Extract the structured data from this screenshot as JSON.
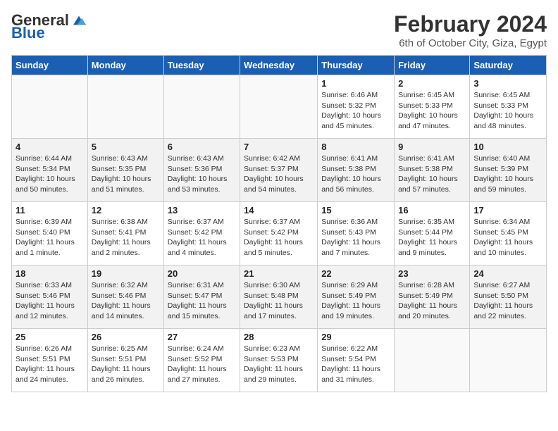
{
  "logo": {
    "general": "General",
    "blue": "Blue"
  },
  "title": "February 2024",
  "subtitle": "6th of October City, Giza, Egypt",
  "days_of_week": [
    "Sunday",
    "Monday",
    "Tuesday",
    "Wednesday",
    "Thursday",
    "Friday",
    "Saturday"
  ],
  "weeks": [
    [
      {
        "day": "",
        "info": ""
      },
      {
        "day": "",
        "info": ""
      },
      {
        "day": "",
        "info": ""
      },
      {
        "day": "",
        "info": ""
      },
      {
        "day": "1",
        "info": "Sunrise: 6:46 AM\nSunset: 5:32 PM\nDaylight: 10 hours and 45 minutes."
      },
      {
        "day": "2",
        "info": "Sunrise: 6:45 AM\nSunset: 5:33 PM\nDaylight: 10 hours and 47 minutes."
      },
      {
        "day": "3",
        "info": "Sunrise: 6:45 AM\nSunset: 5:33 PM\nDaylight: 10 hours and 48 minutes."
      }
    ],
    [
      {
        "day": "4",
        "info": "Sunrise: 6:44 AM\nSunset: 5:34 PM\nDaylight: 10 hours and 50 minutes."
      },
      {
        "day": "5",
        "info": "Sunrise: 6:43 AM\nSunset: 5:35 PM\nDaylight: 10 hours and 51 minutes."
      },
      {
        "day": "6",
        "info": "Sunrise: 6:43 AM\nSunset: 5:36 PM\nDaylight: 10 hours and 53 minutes."
      },
      {
        "day": "7",
        "info": "Sunrise: 6:42 AM\nSunset: 5:37 PM\nDaylight: 10 hours and 54 minutes."
      },
      {
        "day": "8",
        "info": "Sunrise: 6:41 AM\nSunset: 5:38 PM\nDaylight: 10 hours and 56 minutes."
      },
      {
        "day": "9",
        "info": "Sunrise: 6:41 AM\nSunset: 5:38 PM\nDaylight: 10 hours and 57 minutes."
      },
      {
        "day": "10",
        "info": "Sunrise: 6:40 AM\nSunset: 5:39 PM\nDaylight: 10 hours and 59 minutes."
      }
    ],
    [
      {
        "day": "11",
        "info": "Sunrise: 6:39 AM\nSunset: 5:40 PM\nDaylight: 11 hours and 1 minute."
      },
      {
        "day": "12",
        "info": "Sunrise: 6:38 AM\nSunset: 5:41 PM\nDaylight: 11 hours and 2 minutes."
      },
      {
        "day": "13",
        "info": "Sunrise: 6:37 AM\nSunset: 5:42 PM\nDaylight: 11 hours and 4 minutes."
      },
      {
        "day": "14",
        "info": "Sunrise: 6:37 AM\nSunset: 5:42 PM\nDaylight: 11 hours and 5 minutes."
      },
      {
        "day": "15",
        "info": "Sunrise: 6:36 AM\nSunset: 5:43 PM\nDaylight: 11 hours and 7 minutes."
      },
      {
        "day": "16",
        "info": "Sunrise: 6:35 AM\nSunset: 5:44 PM\nDaylight: 11 hours and 9 minutes."
      },
      {
        "day": "17",
        "info": "Sunrise: 6:34 AM\nSunset: 5:45 PM\nDaylight: 11 hours and 10 minutes."
      }
    ],
    [
      {
        "day": "18",
        "info": "Sunrise: 6:33 AM\nSunset: 5:46 PM\nDaylight: 11 hours and 12 minutes."
      },
      {
        "day": "19",
        "info": "Sunrise: 6:32 AM\nSunset: 5:46 PM\nDaylight: 11 hours and 14 minutes."
      },
      {
        "day": "20",
        "info": "Sunrise: 6:31 AM\nSunset: 5:47 PM\nDaylight: 11 hours and 15 minutes."
      },
      {
        "day": "21",
        "info": "Sunrise: 6:30 AM\nSunset: 5:48 PM\nDaylight: 11 hours and 17 minutes."
      },
      {
        "day": "22",
        "info": "Sunrise: 6:29 AM\nSunset: 5:49 PM\nDaylight: 11 hours and 19 minutes."
      },
      {
        "day": "23",
        "info": "Sunrise: 6:28 AM\nSunset: 5:49 PM\nDaylight: 11 hours and 20 minutes."
      },
      {
        "day": "24",
        "info": "Sunrise: 6:27 AM\nSunset: 5:50 PM\nDaylight: 11 hours and 22 minutes."
      }
    ],
    [
      {
        "day": "25",
        "info": "Sunrise: 6:26 AM\nSunset: 5:51 PM\nDaylight: 11 hours and 24 minutes."
      },
      {
        "day": "26",
        "info": "Sunrise: 6:25 AM\nSunset: 5:51 PM\nDaylight: 11 hours and 26 minutes."
      },
      {
        "day": "27",
        "info": "Sunrise: 6:24 AM\nSunset: 5:52 PM\nDaylight: 11 hours and 27 minutes."
      },
      {
        "day": "28",
        "info": "Sunrise: 6:23 AM\nSunset: 5:53 PM\nDaylight: 11 hours and 29 minutes."
      },
      {
        "day": "29",
        "info": "Sunrise: 6:22 AM\nSunset: 5:54 PM\nDaylight: 11 hours and 31 minutes."
      },
      {
        "day": "",
        "info": ""
      },
      {
        "day": "",
        "info": ""
      }
    ]
  ]
}
